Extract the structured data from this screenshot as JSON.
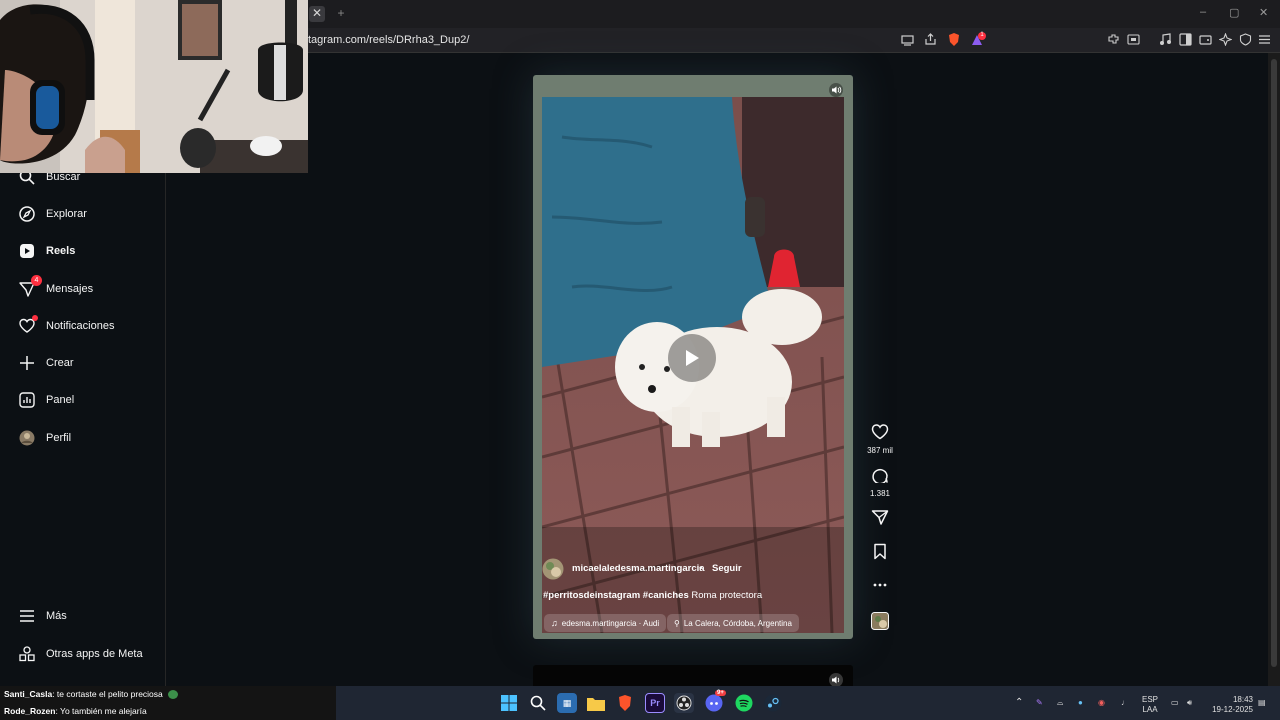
{
  "browser": {
    "tab_close": "✕",
    "new_tab": "+",
    "url": "tagram.com/reels/DRrha3_Dup2/",
    "window_controls": [
      "–",
      "▢",
      "✕"
    ],
    "extension_badge": "1"
  },
  "sidebar": {
    "items": [
      {
        "label": "Buscar",
        "icon": "search-icon"
      },
      {
        "label": "Explorar",
        "icon": "compass-icon"
      },
      {
        "label": "Reels",
        "icon": "reels-icon"
      },
      {
        "label": "Mensajes",
        "icon": "messenger-icon",
        "badge": "4"
      },
      {
        "label": "Notificaciones",
        "icon": "heart-icon"
      },
      {
        "label": "Crear",
        "icon": "plus-icon"
      },
      {
        "label": "Panel",
        "icon": "chart-icon"
      },
      {
        "label": "Perfil",
        "icon": "avatar-icon"
      }
    ],
    "bottom": [
      {
        "label": "Más",
        "icon": "menu-icon"
      },
      {
        "label": "Otras apps de Meta",
        "icon": "meta-apps-icon"
      }
    ]
  },
  "reel": {
    "username": "micaelaledesma.martingarcia",
    "separator": "•",
    "follow": "Seguir",
    "caption_tags": "#perritosdeinstagram #caniches",
    "caption_text": " Roma protectora",
    "audio": "edesma.martingarcia · Audi",
    "location": "La Calera, Córdoba, Argentina",
    "likes": "387 mil",
    "comments": "1.381"
  },
  "chat": [
    {
      "user": "Santi_Casla",
      "text": ": te cortaste el pelito preciosa"
    },
    {
      "user": "Rode_Rozen",
      "text": ": Yo también me alejaría"
    }
  ],
  "taskbar": {
    "lang": "ESP",
    "layout": "LAA",
    "time": "18:43",
    "date": "19-12-2025",
    "discord_badge": "9+"
  },
  "colors": {
    "page_bg": "#0c1014",
    "badge": "#ff3040",
    "reel_border": "#6f7d70"
  }
}
